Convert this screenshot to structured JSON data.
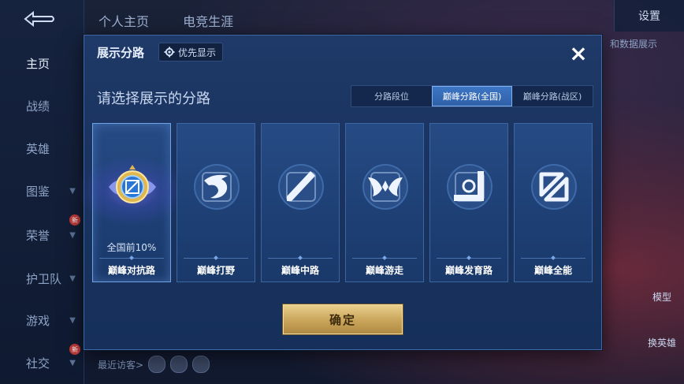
{
  "nav": {
    "items": [
      {
        "label": "主页",
        "chevron": false,
        "badge": ""
      },
      {
        "label": "战绩",
        "chevron": false,
        "badge": ""
      },
      {
        "label": "英雄",
        "chevron": false,
        "badge": ""
      },
      {
        "label": "图鉴",
        "chevron": true,
        "badge": ""
      },
      {
        "label": "荣誉",
        "chevron": true,
        "badge": "新"
      },
      {
        "label": "护卫队",
        "chevron": true,
        "badge": ""
      },
      {
        "label": "游戏",
        "chevron": true,
        "badge": ""
      },
      {
        "label": "社交",
        "chevron": true,
        "badge": "新"
      }
    ]
  },
  "top_tabs": [
    "个人主页",
    "电竞生涯"
  ],
  "top_right": {
    "settings": "设置"
  },
  "right_hint": "和数据展示",
  "side_buttons": {
    "model": "模型",
    "swap_hero": "换英雄"
  },
  "visitors_label": "最近访客>",
  "dialog": {
    "title": "展示分路",
    "priority_button": "优先显示",
    "close_icon": "×",
    "subtitle": "请选择展示的分路",
    "segments": [
      {
        "label": "分路段位",
        "active": false
      },
      {
        "label": "巅峰分路(全国)",
        "active": true
      },
      {
        "label": "巅峰分路(战区)",
        "active": false
      }
    ],
    "cards": [
      {
        "label": "巅峰对抗路",
        "icon": "crest-emblem-icon",
        "rank": "全国前10%",
        "selected": true
      },
      {
        "label": "巅峰打野",
        "icon": "dragon-icon",
        "rank": "",
        "selected": false
      },
      {
        "label": "巅峰中路",
        "icon": "diagonal-lane-icon",
        "rank": "",
        "selected": false
      },
      {
        "label": "巅峰游走",
        "icon": "wings-icon",
        "rank": "",
        "selected": false
      },
      {
        "label": "巅峰发育路",
        "icon": "corner-lane-icon",
        "rank": "",
        "selected": false
      },
      {
        "label": "巅峰全能",
        "icon": "split-square-icon",
        "rank": "",
        "selected": false
      }
    ],
    "confirm_button": "确定"
  },
  "colors": {
    "dialog_bg": "#1f3a68",
    "card_bg": "#264b84",
    "accent_gold": "#c9a45a",
    "segment_active": "#3e77c6"
  }
}
